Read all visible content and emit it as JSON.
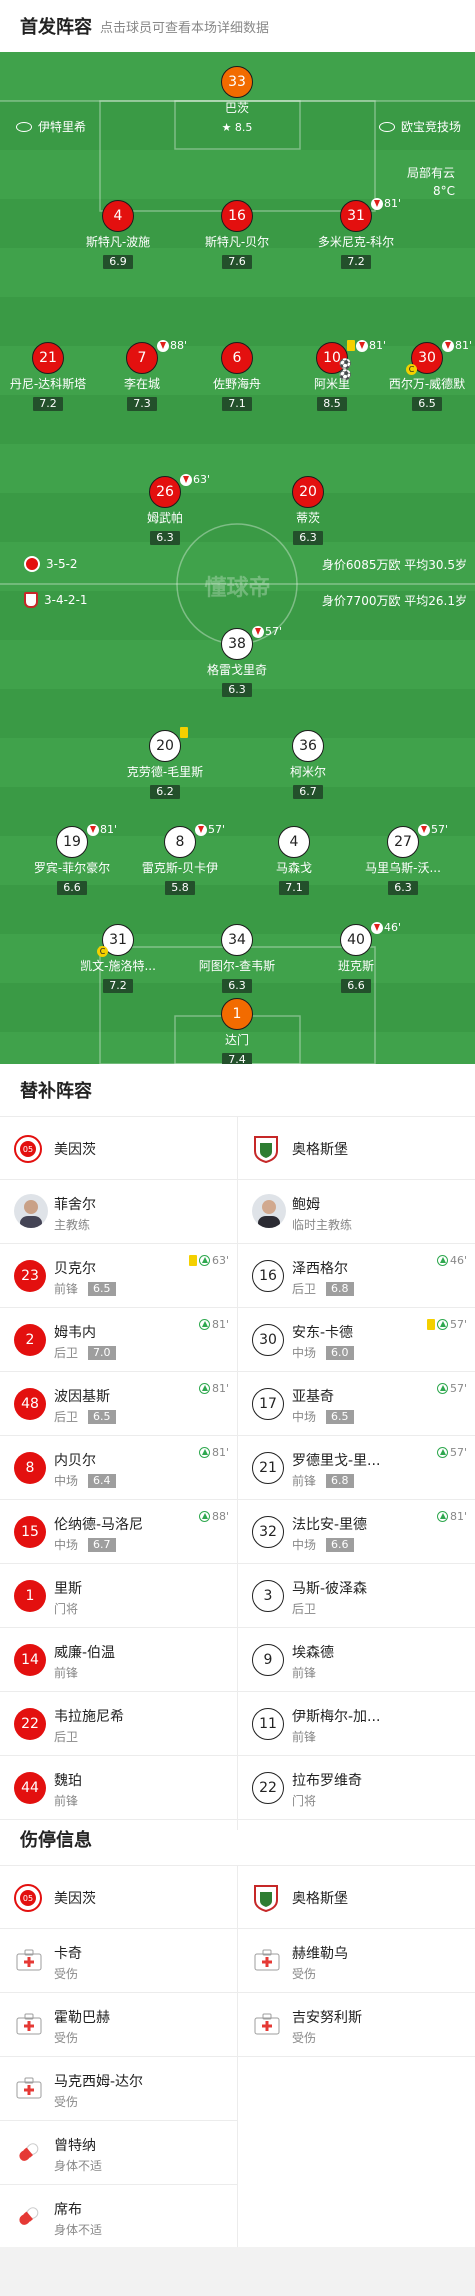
{
  "header": {
    "title": "首发阵容",
    "subtitle": "点击球员可查看本场详细数据"
  },
  "pitch": {
    "home_team": "伊特里希",
    "away_team": "欧宝竞技场",
    "weather_line1": "局部有云",
    "weather_line2": "8°C",
    "watermark": "懂球帝",
    "home_formation": "3-5-2",
    "home_value": "身价6085万欧 平均30.5岁",
    "away_formation": "3-4-2-1",
    "away_value": "身价7700万欧 平均26.1岁",
    "players": [
      {
        "no": "33",
        "name": "巴茨",
        "rating": "8.5",
        "color": "org",
        "star": true
      },
      {
        "no": "4",
        "name": "斯特凡-波施",
        "rating": "6.9",
        "color": "red"
      },
      {
        "no": "16",
        "name": "斯特凡-贝尔",
        "rating": "7.6",
        "color": "red"
      },
      {
        "no": "31",
        "name": "多米尼克-科尔",
        "rating": "7.2",
        "color": "red",
        "sub": "81'"
      },
      {
        "no": "21",
        "name": "丹尼-达科斯塔",
        "rating": "7.2",
        "color": "red"
      },
      {
        "no": "7",
        "name": "李在城",
        "rating": "7.3",
        "color": "red",
        "sub": "88'"
      },
      {
        "no": "6",
        "name": "佐野海舟",
        "rating": "7.1",
        "color": "red"
      },
      {
        "no": "10",
        "name": "阿米里",
        "rating": "8.5",
        "color": "red",
        "sub": "81'",
        "yellow": true,
        "goals": 2
      },
      {
        "no": "30",
        "name": "西尔万-威德默",
        "rating": "6.5",
        "color": "red",
        "sub": "81'",
        "ycard": true
      },
      {
        "no": "26",
        "name": "姆武帕",
        "rating": "6.3",
        "color": "red",
        "sub": "63'"
      },
      {
        "no": "20",
        "name": "蒂茨",
        "rating": "6.3",
        "color": "red"
      },
      {
        "no": "38",
        "name": "格雷戈里奇",
        "rating": "6.3",
        "color": "wht",
        "sub": "57'"
      },
      {
        "no": "20",
        "name": "克劳德-毛里斯",
        "rating": "6.2",
        "color": "wht",
        "yellow": true
      },
      {
        "no": "36",
        "name": "柯米尔",
        "rating": "6.7",
        "color": "wht"
      },
      {
        "no": "19",
        "name": "罗宾-菲尔豪尔",
        "rating": "6.6",
        "color": "wht",
        "sub": "81'"
      },
      {
        "no": "8",
        "name": "雷克斯-贝卡伊",
        "rating": "5.8",
        "color": "wht",
        "sub": "57'"
      },
      {
        "no": "4",
        "name": "马森戈",
        "rating": "7.1",
        "color": "wht"
      },
      {
        "no": "27",
        "name": "马里乌斯-沃...",
        "rating": "6.3",
        "color": "wht",
        "sub": "57'"
      },
      {
        "no": "31",
        "name": "凯文-施洛特...",
        "rating": "7.2",
        "color": "wht",
        "ycard": true
      },
      {
        "no": "34",
        "name": "阿图尔-查韦斯",
        "rating": "6.3",
        "color": "wht"
      },
      {
        "no": "40",
        "name": "班克斯",
        "rating": "6.6",
        "color": "wht",
        "sub": "46'"
      },
      {
        "no": "1",
        "name": "达门",
        "rating": "7.4",
        "color": "org"
      }
    ]
  },
  "subs": {
    "title": "替补阵容",
    "home_name": "美因茨",
    "away_name": "奥格斯堡",
    "home_coach": {
      "name": "菲舍尔",
      "role": "主教练"
    },
    "away_coach": {
      "name": "鲍姆",
      "role": "临时主教练"
    },
    "home": [
      {
        "no": "23",
        "name": "贝克尔",
        "pos": "前锋",
        "rating": "6.5",
        "ev": "63'",
        "yellow": true
      },
      {
        "no": "2",
        "name": "姆韦内",
        "pos": "后卫",
        "rating": "7.0",
        "ev": "81'"
      },
      {
        "no": "48",
        "name": "波因基斯",
        "pos": "后卫",
        "rating": "6.5",
        "ev": "81'"
      },
      {
        "no": "8",
        "name": "内贝尔",
        "pos": "中场",
        "rating": "6.4",
        "ev": "81'"
      },
      {
        "no": "15",
        "name": "伦纳德-马洛尼",
        "pos": "中场",
        "rating": "6.7",
        "ev": "88'"
      },
      {
        "no": "1",
        "name": "里斯",
        "pos": "门将"
      },
      {
        "no": "14",
        "name": "威廉-伯温",
        "pos": "前锋"
      },
      {
        "no": "22",
        "name": "韦拉施尼希",
        "pos": "后卫"
      },
      {
        "no": "44",
        "name": "魏珀",
        "pos": "前锋"
      }
    ],
    "away": [
      {
        "no": "16",
        "name": "泽西格尔",
        "pos": "后卫",
        "rating": "6.8",
        "ev": "46'"
      },
      {
        "no": "30",
        "name": "安东-卡德",
        "pos": "中场",
        "rating": "6.0",
        "ev": "57'",
        "yellow": true
      },
      {
        "no": "17",
        "name": "亚基奇",
        "pos": "中场",
        "rating": "6.5",
        "ev": "57'"
      },
      {
        "no": "21",
        "name": "罗德里戈-里...",
        "pos": "前锋",
        "rating": "6.8",
        "ev": "57'"
      },
      {
        "no": "32",
        "name": "法比安-里德",
        "pos": "中场",
        "rating": "6.6",
        "ev": "81'"
      },
      {
        "no": "3",
        "name": "马斯-彼泽森",
        "pos": "后卫"
      },
      {
        "no": "9",
        "name": "埃森德",
        "pos": "前锋"
      },
      {
        "no": "11",
        "name": "伊斯梅尔-加...",
        "pos": "前锋"
      },
      {
        "no": "22",
        "name": "拉布罗维奇",
        "pos": "门将"
      }
    ]
  },
  "injuries": {
    "title": "伤停信息",
    "home_name": "美因茨",
    "away_name": "奥格斯堡",
    "home": [
      {
        "name": "卡奇",
        "status": "受伤",
        "icon": "medical-kit-icon"
      },
      {
        "name": "霍勒巴赫",
        "status": "受伤",
        "icon": "medical-kit-icon"
      },
      {
        "name": "马克西姆-达尔",
        "status": "受伤",
        "icon": "medical-kit-icon"
      },
      {
        "name": "曾特纳",
        "status": "身体不适",
        "icon": "pill-icon"
      },
      {
        "name": "席布",
        "status": "身体不适",
        "icon": "pill-icon"
      }
    ],
    "away": [
      {
        "name": "赫维勒乌",
        "status": "受伤",
        "icon": "medical-kit-icon"
      },
      {
        "name": "吉安努利斯",
        "status": "受伤",
        "icon": "medical-kit-icon"
      }
    ]
  },
  "colors": {
    "pitch": "#3a9a45",
    "home_red": "#e3100f",
    "accent_orange": "#f26b00",
    "sub_green": "#2fa84f"
  }
}
